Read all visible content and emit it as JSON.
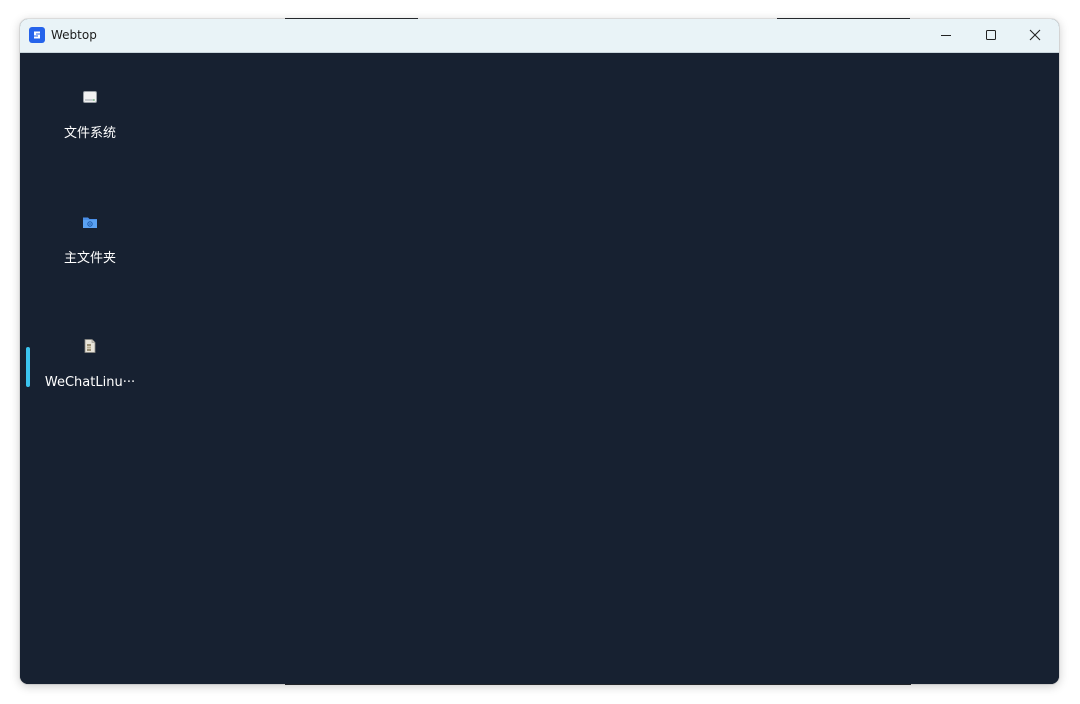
{
  "window": {
    "title": "Webtop",
    "app_icon": "webtop-logo-icon",
    "controls": {
      "minimize_icon": "minimize-icon",
      "maximize_icon": "maximize-icon",
      "close_icon": "close-icon"
    }
  },
  "desktop": {
    "background_color": "#172131",
    "selection_color": "#3bc4ef",
    "items": [
      {
        "label": "文件系统",
        "icon": "drive-icon"
      },
      {
        "label": "主文件夹",
        "icon": "home-folder-icon"
      },
      {
        "label": "WeChatLinu···",
        "icon": "archive-file-icon"
      }
    ]
  }
}
